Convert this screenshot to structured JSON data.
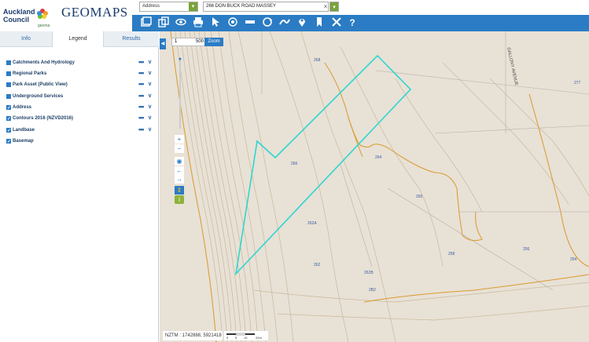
{
  "header": {
    "logo_line1": "Auckland",
    "logo_line2": "Council",
    "logo_sub": "geoma",
    "app_title": "GEOMAPS"
  },
  "search": {
    "type_selected": "Address",
    "address_value": "266 DON BUCK ROAD MASSEY",
    "clear_glyph": "×"
  },
  "toolbar": {
    "icons": [
      "layers-icon",
      "copy-icon",
      "eye-icon",
      "print-icon",
      "pointer-icon",
      "locate-icon",
      "measure-icon",
      "refresh-icon",
      "route-icon",
      "marker-icon",
      "bookmark-icon",
      "tools-icon",
      "help-icon"
    ],
    "help_label": "?"
  },
  "panel": {
    "tabs": [
      {
        "label": "Info"
      },
      {
        "label": "Legend"
      },
      {
        "label": "Results"
      }
    ],
    "active_tab": "Legend",
    "layers": [
      {
        "label": "Catchments And Hydrology",
        "checked": false,
        "more": "•••",
        "chev": "∨"
      },
      {
        "label": "Regional Parks",
        "checked": false,
        "more": "•••",
        "chev": "∨"
      },
      {
        "label": "Park Asset (Public View)",
        "checked": false,
        "more": "•••",
        "chev": "∨"
      },
      {
        "label": "Underground Services",
        "checked": false,
        "more": "•••",
        "chev": "∨"
      },
      {
        "label": "Address",
        "checked": true,
        "more": "•••",
        "chev": "∨"
      },
      {
        "label": "Contours 2016 (NZVD2016)",
        "checked": true,
        "more": "•••",
        "chev": "∨"
      },
      {
        "label": "Landbase",
        "checked": true,
        "more": "•••",
        "chev": "∨"
      },
      {
        "label": "Basemap",
        "checked": true
      }
    ]
  },
  "map": {
    "scale_prefix": "1",
    "scale_value": "500",
    "zoom_label": "Zoom",
    "collapse_glyph": "◀",
    "controls": {
      "zoom_in": "+",
      "zoom_out": "−",
      "globe": "◉",
      "back": "←",
      "forward": "→"
    },
    "road_label": "GALLONY AVENUE",
    "address_numbers": [
      "268",
      "277",
      "264",
      "266",
      "265",
      "262A",
      "262",
      "262B",
      "258",
      "256",
      "254",
      "2B2"
    ],
    "coords_text": "NZTM : 1742888, 5921418",
    "scalebar_labels": [
      "0",
      "5",
      "10",
      "20m"
    ],
    "colors": {
      "parcel_outline": "#2ed6d0",
      "contour": "#d99a2b",
      "toolbar": "#2b7cc4"
    }
  }
}
